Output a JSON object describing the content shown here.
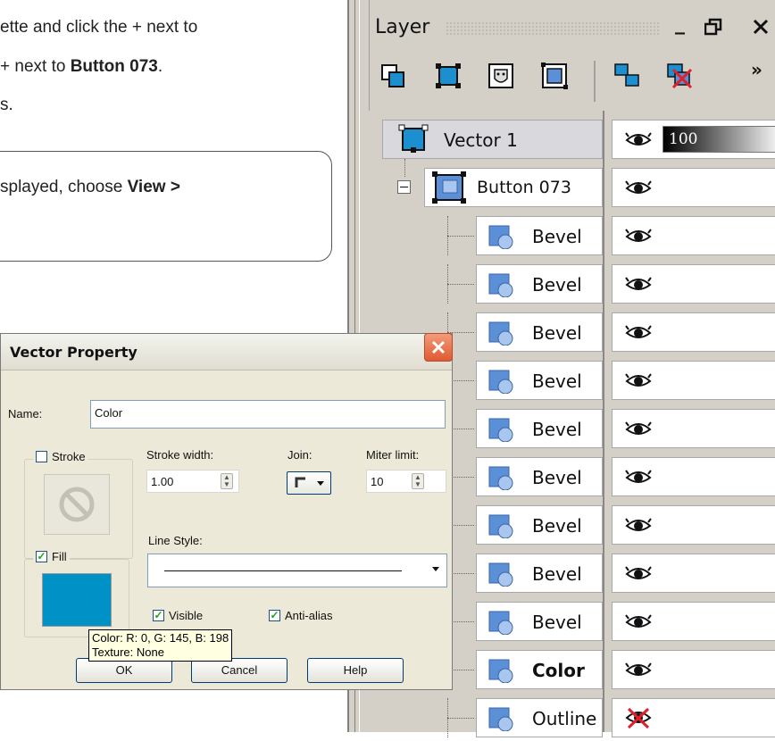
{
  "document": {
    "line1": "ette and click the + next to",
    "line2_prefix": "+ next to ",
    "line2_bold": "Button 073",
    "line2_suffix": ".",
    "line3": "s.",
    "note_prefix": "splayed, choose ",
    "note_bold": "View >"
  },
  "layer_palette": {
    "title": "Layer",
    "window_buttons": [
      "_",
      "🗗",
      "✕"
    ],
    "more_glyph": "»",
    "opacity_value": "100",
    "layers": [
      {
        "name": "Vector 1",
        "type": "vector",
        "visible": true,
        "selected": true
      },
      {
        "name": "Button 073",
        "type": "group",
        "visible": true
      },
      {
        "name": "Bevel",
        "type": "object",
        "visible": true
      },
      {
        "name": "Bevel",
        "type": "object",
        "visible": true
      },
      {
        "name": "Bevel",
        "type": "object",
        "visible": true
      },
      {
        "name": "Bevel",
        "type": "object",
        "visible": true
      },
      {
        "name": "Bevel",
        "type": "object",
        "visible": true
      },
      {
        "name": "Bevel",
        "type": "object",
        "visible": true
      },
      {
        "name": "Bevel",
        "type": "object",
        "visible": true
      },
      {
        "name": "Bevel",
        "type": "object",
        "visible": true
      },
      {
        "name": "Bevel",
        "type": "object",
        "visible": true
      },
      {
        "name": "Color",
        "type": "object",
        "visible": true,
        "bold": true
      },
      {
        "name": "Outline",
        "type": "object",
        "visible": false
      }
    ],
    "colors": {
      "accent": "#1b8fd0",
      "object_icon": "#5b8fd6",
      "hidden_mark": "#e0202a"
    }
  },
  "dialog": {
    "title": "Vector Property",
    "name_label": "Name:",
    "name_value": "Color",
    "stroke_label": "Stroke",
    "stroke_checked": false,
    "stroke_width_label": "Stroke width:",
    "stroke_width_value": "1.00",
    "join_label": "Join:",
    "miter_label": "Miter limit:",
    "miter_value": "10",
    "line_style_label": "Line Style:",
    "fill_label": "Fill",
    "fill_checked": true,
    "fill_color": "#0091c6",
    "visible_label": "Visible",
    "visible_checked": true,
    "antialias_label": "Anti-alias",
    "antialias_checked": true,
    "tooltip_line1": "Color: R: 0, G: 145, B: 198",
    "tooltip_line2": "Texture: None",
    "ok_label": "OK",
    "cancel_label": "Cancel",
    "help_label": "Help"
  }
}
